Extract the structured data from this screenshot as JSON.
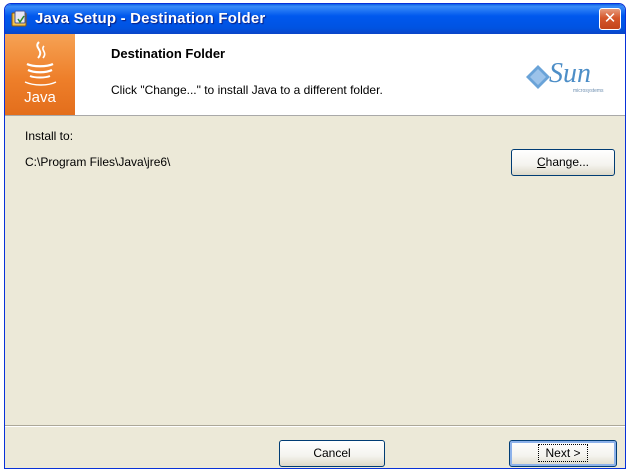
{
  "window": {
    "title": "Java Setup - Destination Folder",
    "close_label": "✕"
  },
  "header": {
    "logo_text": "Java",
    "title": "Destination Folder",
    "description": "Click \"Change...\" to install Java to a different folder.",
    "brand": "Sun",
    "brand_sub": "microsystems"
  },
  "body": {
    "install_label": "Install to:",
    "install_path": "C:\\Program Files\\Java\\jre6\\",
    "change_button": "Change..."
  },
  "footer": {
    "cancel_button": "Cancel",
    "next_button": "Next >"
  },
  "colors": {
    "titlebar": "#0058ee",
    "dialog_bg": "#ece9d8",
    "java_orange": "#ee7f2a",
    "sun_blue": "#4d8ec7"
  }
}
